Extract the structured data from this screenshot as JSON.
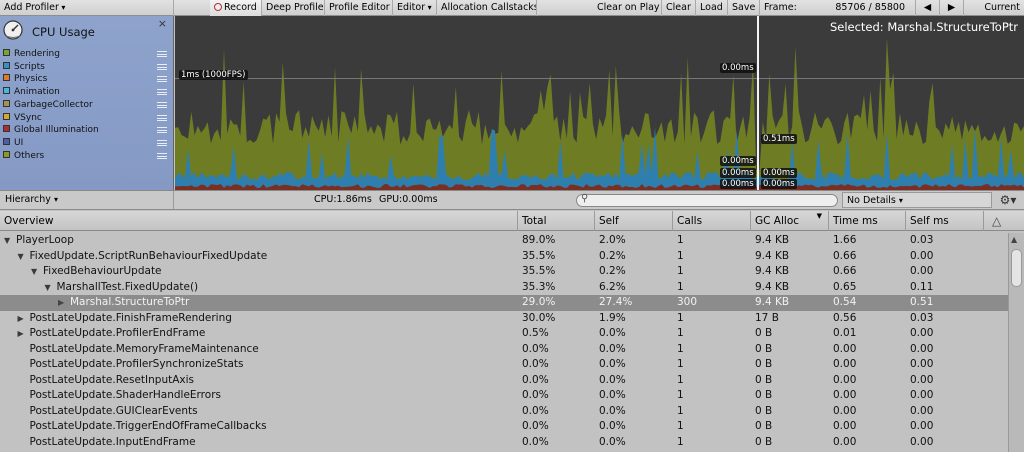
{
  "toolbar": {
    "add_profiler": "Add Profiler",
    "record": "Record",
    "deep_profile": "Deep Profile",
    "profiler_editor": "Profile Editor",
    "editor": "Editor",
    "allocation_callstacks": "Allocation Callstacks",
    "clear_on_play": "Clear on Play",
    "clear": "Clear",
    "load": "Load",
    "save": "Save",
    "frame_label": "Frame:",
    "frame_value": "85706 / 85800",
    "prev_icon": "prev-frame-icon",
    "next_icon": "next-frame-icon",
    "current": "Current"
  },
  "legend": {
    "title": "CPU Usage",
    "close": "×",
    "items": [
      {
        "label": "Rendering",
        "color": "#7aa335"
      },
      {
        "label": "Scripts",
        "color": "#3b8fc0"
      },
      {
        "label": "Physics",
        "color": "#e07b2a"
      },
      {
        "label": "Animation",
        "color": "#46b8d8"
      },
      {
        "label": "GarbageCollector",
        "color": "#a19450"
      },
      {
        "label": "VSync",
        "color": "#d6a72e"
      },
      {
        "label": "Global Illumination",
        "color": "#a83232"
      },
      {
        "label": "UI",
        "color": "#4b5ea8"
      },
      {
        "label": "Others",
        "color": "#8a9a24"
      }
    ]
  },
  "chart": {
    "selected": "Selected: Marshal.StructureToPtr",
    "fps_line": "1ms (1000FPS)",
    "marker_top": "0.00ms",
    "marker_mid": "0.51ms",
    "marker_a": "0.00ms",
    "marker_b": "0.00ms",
    "marker_c": "0.00ms",
    "marker_d": "0.00ms",
    "marker_e": "0.00ms"
  },
  "subbar": {
    "view": "Hierarchy",
    "cpu": "CPU:1.86ms",
    "gpu": "GPU:0.00ms",
    "search_placeholder": "",
    "details": "No Details"
  },
  "table": {
    "columns": [
      "Overview",
      "Total",
      "Self",
      "Calls",
      "GC Alloc",
      "Time ms",
      "Self ms"
    ],
    "rows": [
      {
        "name": "PlayerLoop",
        "depth": 0,
        "arrow": "down",
        "total": "89.0%",
        "self": "2.0%",
        "calls": "1",
        "gc": "9.4 KB",
        "time": "1.66",
        "selfms": "0.03"
      },
      {
        "name": "FixedUpdate.ScriptRunBehaviourFixedUpdate",
        "depth": 1,
        "arrow": "down",
        "total": "35.5%",
        "self": "0.2%",
        "calls": "1",
        "gc": "9.4 KB",
        "time": "0.66",
        "selfms": "0.00"
      },
      {
        "name": "FixedBehaviourUpdate",
        "depth": 2,
        "arrow": "down",
        "total": "35.5%",
        "self": "0.2%",
        "calls": "1",
        "gc": "9.4 KB",
        "time": "0.66",
        "selfms": "0.00"
      },
      {
        "name": "MarshallTest.FixedUpdate()",
        "depth": 3,
        "arrow": "down",
        "total": "35.3%",
        "self": "6.2%",
        "calls": "1",
        "gc": "9.4 KB",
        "time": "0.65",
        "selfms": "0.11"
      },
      {
        "name": "Marshal.StructureToPtr",
        "depth": 4,
        "arrow": "right",
        "total": "29.0%",
        "self": "27.4%",
        "calls": "300",
        "gc": "9.4 KB",
        "time": "0.54",
        "selfms": "0.51",
        "selected": true
      },
      {
        "name": "PostLateUpdate.FinishFrameRendering",
        "depth": 1,
        "arrow": "right",
        "total": "30.0%",
        "self": "1.9%",
        "calls": "1",
        "gc": "17 B",
        "time": "0.56",
        "selfms": "0.03"
      },
      {
        "name": "PostLateUpdate.ProfilerEndFrame",
        "depth": 1,
        "arrow": "right",
        "total": "0.5%",
        "self": "0.0%",
        "calls": "1",
        "gc": "0 B",
        "time": "0.01",
        "selfms": "0.00"
      },
      {
        "name": "PostLateUpdate.MemoryFrameMaintenance",
        "depth": 1,
        "arrow": "",
        "total": "0.0%",
        "self": "0.0%",
        "calls": "1",
        "gc": "0 B",
        "time": "0.00",
        "selfms": "0.00"
      },
      {
        "name": "PostLateUpdate.ProfilerSynchronizeStats",
        "depth": 1,
        "arrow": "",
        "total": "0.0%",
        "self": "0.0%",
        "calls": "1",
        "gc": "0 B",
        "time": "0.00",
        "selfms": "0.00"
      },
      {
        "name": "PostLateUpdate.ResetInputAxis",
        "depth": 1,
        "arrow": "",
        "total": "0.0%",
        "self": "0.0%",
        "calls": "1",
        "gc": "0 B",
        "time": "0.00",
        "selfms": "0.00"
      },
      {
        "name": "PostLateUpdate.ShaderHandleErrors",
        "depth": 1,
        "arrow": "",
        "total": "0.0%",
        "self": "0.0%",
        "calls": "1",
        "gc": "0 B",
        "time": "0.00",
        "selfms": "0.00"
      },
      {
        "name": "PostLateUpdate.GUIClearEvents",
        "depth": 1,
        "arrow": "",
        "total": "0.0%",
        "self": "0.0%",
        "calls": "1",
        "gc": "0 B",
        "time": "0.00",
        "selfms": "0.00"
      },
      {
        "name": "PostLateUpdate.TriggerEndOfFrameCallbacks",
        "depth": 1,
        "arrow": "",
        "total": "0.0%",
        "self": "0.0%",
        "calls": "1",
        "gc": "0 B",
        "time": "0.00",
        "selfms": "0.00"
      },
      {
        "name": "PostLateUpdate.InputEndFrame",
        "depth": 1,
        "arrow": "",
        "total": "0.0%",
        "self": "0.0%",
        "calls": "1",
        "gc": "0 B",
        "time": "0.00",
        "selfms": "0.00"
      }
    ]
  }
}
